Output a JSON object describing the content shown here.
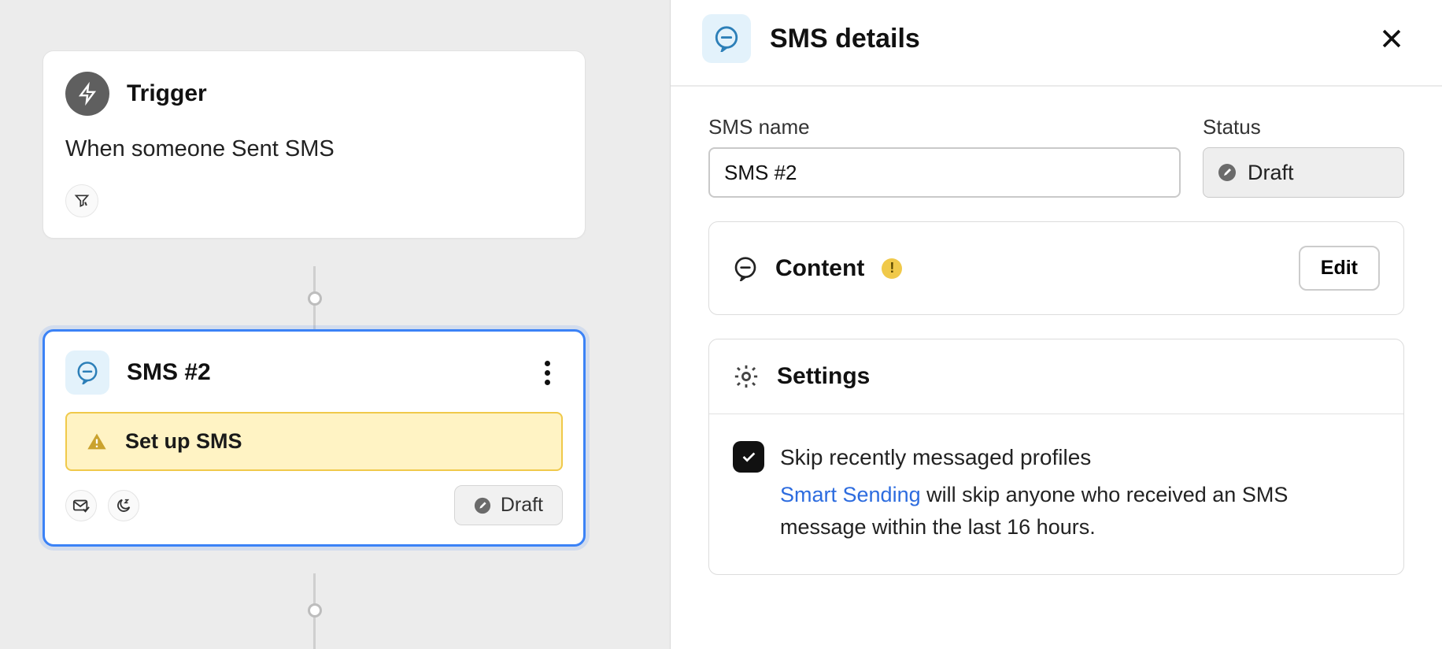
{
  "canvas": {
    "trigger": {
      "title": "Trigger",
      "description": "When someone Sent SMS"
    },
    "sms_node": {
      "title": "SMS #2",
      "setup_banner": "Set up SMS",
      "status": "Draft"
    }
  },
  "panel": {
    "title": "SMS details",
    "fields": {
      "name_label": "SMS name",
      "name_value": "SMS #2",
      "status_label": "Status",
      "status_value": "Draft"
    },
    "content_section": {
      "title": "Content",
      "edit_label": "Edit"
    },
    "settings_section": {
      "title": "Settings",
      "skip_title": "Skip recently messaged profiles",
      "smart_link": "Smart Sending",
      "skip_desc_rest": " will skip anyone who received an SMS message within the last 16 hours."
    }
  }
}
